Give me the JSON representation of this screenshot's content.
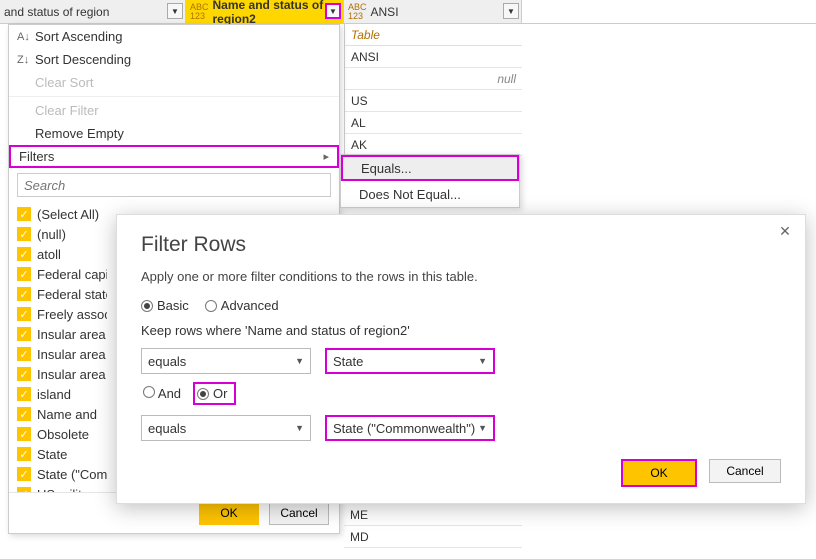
{
  "columns": {
    "col1": {
      "label": "and status of region",
      "type": "ABC\n123"
    },
    "col2": {
      "label": "Name and status of region2",
      "type": "ABC\n123"
    },
    "col3": {
      "label": "ANSI",
      "type": "ABC\n123"
    }
  },
  "context_menu": {
    "sort_asc": "Sort Ascending",
    "sort_desc": "Sort Descending",
    "clear_sort": "Clear Sort",
    "clear_filter": "Clear Filter",
    "remove_empty": "Remove Empty",
    "filters": "Filters",
    "search_placeholder": "Search",
    "items": [
      "(Select All)",
      "(null)",
      "atoll",
      "Federal capital",
      "Federal state",
      "Freely associated",
      "Insular area",
      "Insular area",
      "Insular area",
      "island",
      "Name and",
      "Obsolete",
      "State",
      "State (\"Commonwealth\")",
      "US military"
    ],
    "ok": "OK",
    "cancel": "Cancel"
  },
  "submenu": {
    "equals": "Equals...",
    "does_not_equal": "Does Not Equal..."
  },
  "right_column": {
    "header": "Table",
    "rows_top": [
      "ANSI",
      "null",
      "US",
      "AL",
      "AK"
    ],
    "rows_bottom": [
      "ME",
      "MD"
    ]
  },
  "dialog": {
    "title": "Filter Rows",
    "hint": "Apply one or more filter conditions to the rows in this table.",
    "basic": "Basic",
    "advanced": "Advanced",
    "keep_label": "Keep rows where 'Name and status of region2'",
    "op1": "equals",
    "val1": "State",
    "and": "And",
    "or": "Or",
    "op2": "equals",
    "val2": "State (\"Commonwealth\")",
    "ok": "OK",
    "cancel": "Cancel"
  }
}
